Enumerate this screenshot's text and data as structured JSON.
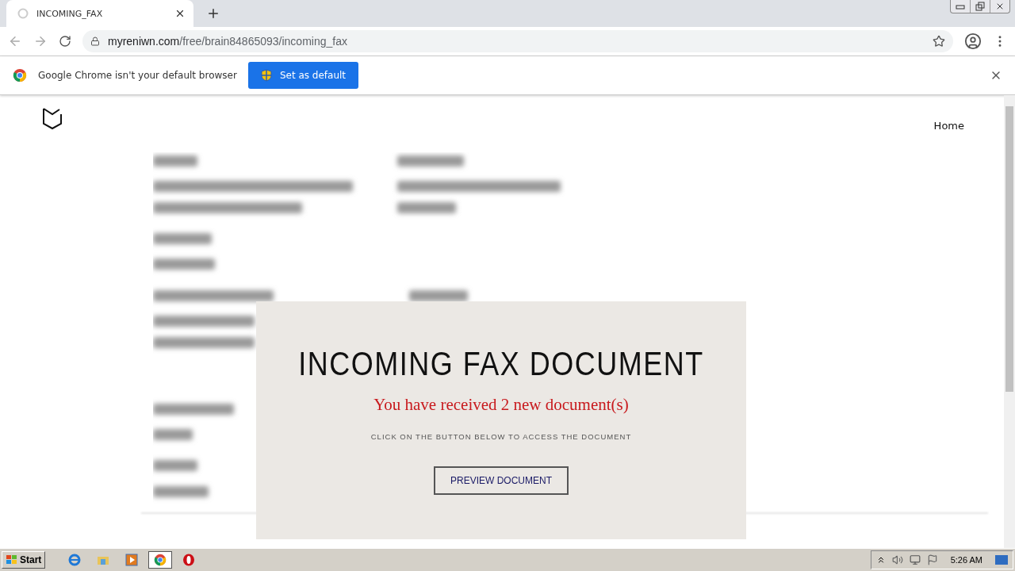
{
  "browser": {
    "tab_title": "INCOMING_FAX",
    "url_host": "myreniwn.com",
    "url_path": "/free/brain84865093/incoming_fax"
  },
  "infobar": {
    "message": "Google Chrome isn't your default browser",
    "button": "Set as default"
  },
  "site": {
    "nav": [
      "Home"
    ]
  },
  "modal": {
    "title": "INCOMING FAX DOCUMENT",
    "subtitle": "You have received 2 new document(s)",
    "instruction": "CLICK ON THE BUTTON BELOW TO ACCESS THE DOCUMENT",
    "button": "PREVIEW DOCUMENT"
  },
  "taskbar": {
    "start": "Start",
    "apps": [
      {
        "kind": "ie",
        "selected": false
      },
      {
        "kind": "folder",
        "selected": false
      },
      {
        "kind": "media",
        "selected": false
      },
      {
        "kind": "chrome",
        "selected": true
      },
      {
        "kind": "opera",
        "selected": false
      }
    ],
    "clock": "5:26 AM"
  }
}
